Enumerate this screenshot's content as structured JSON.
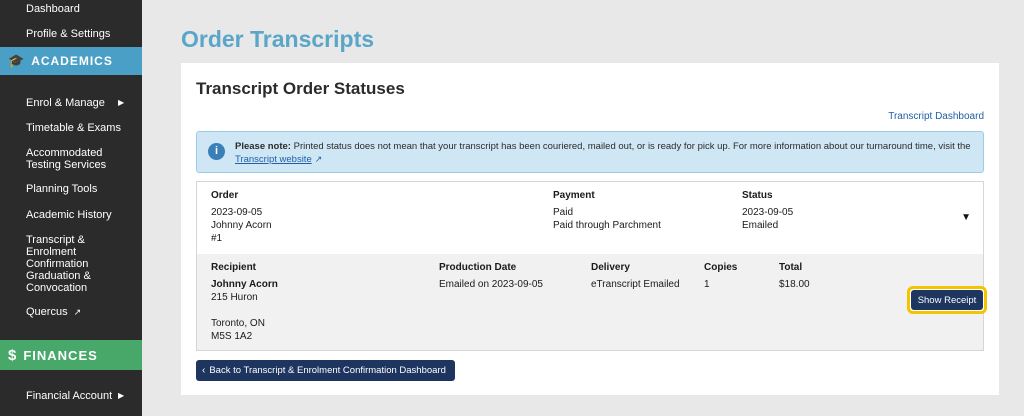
{
  "sidebar": {
    "top_items": [
      {
        "label": "Dashboard"
      },
      {
        "label": "Profile & Settings"
      }
    ],
    "academics_header": "ACADEMICS",
    "academics_items": [
      {
        "label": "Enrol & Manage"
      },
      {
        "label": "Timetable & Exams"
      },
      {
        "label": "Accommodated Testing Services"
      },
      {
        "label": "Planning Tools"
      },
      {
        "label": "Academic History"
      },
      {
        "label": "Transcript & Enrolment Confirmation"
      },
      {
        "label": "Graduation & Convocation"
      },
      {
        "label": "Quercus"
      }
    ],
    "finances_header": "FINANCES",
    "finances_items": [
      {
        "label": "Financial Account"
      }
    ]
  },
  "page": {
    "title": "Order Transcripts",
    "card_title": "Transcript Order Statuses",
    "dashboard_link": "Transcript Dashboard",
    "note": {
      "label": "Please note:",
      "text": "Printed status does not mean that your transcript has been couriered, mailed out, or is ready for pick up. For more information about our turnaround time, visit the",
      "link": "Transcript website"
    },
    "order": {
      "order_label": "Order",
      "order_date": "2023-09-05",
      "order_name": "Johnny Acorn",
      "order_num": "#1",
      "payment_label": "Payment",
      "payment_status": "Paid",
      "payment_method": "Paid through Parchment",
      "status_label": "Status",
      "status_date": "2023-09-05",
      "status_value": "Emailed",
      "recipient_label": "Recipient",
      "recipient_name": "Johnny Acorn",
      "recipient_address1": "215 Huron",
      "recipient_city": "Toronto, ON",
      "recipient_postal": "M5S 1A2",
      "production_label": "Production Date",
      "production_value": "Emailed on 2023-09-05",
      "delivery_label": "Delivery",
      "delivery_value": "eTranscript Emailed",
      "copies_label": "Copies",
      "copies_value": "1",
      "total_label": "Total",
      "total_value": "$18.00",
      "receipt_button": "Show Receipt"
    },
    "back_button": "Back to Transcript & Enrolment Confirmation Dashboard"
  }
}
